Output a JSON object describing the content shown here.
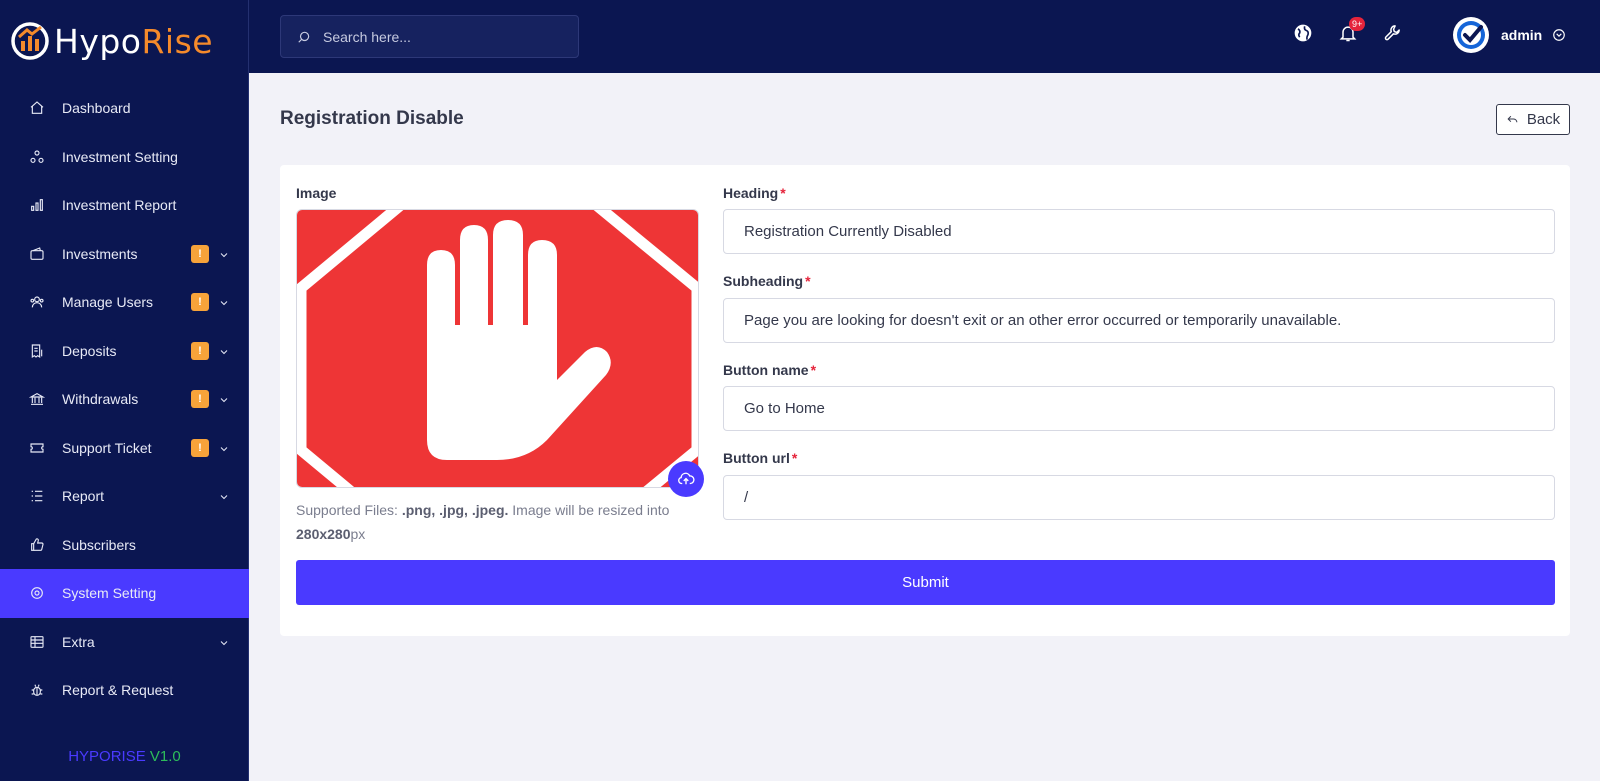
{
  "app": {
    "logo_part1": "Hypo",
    "logo_part2": "Rise",
    "version_name": "HYPORISE",
    "version_number": "V1.0"
  },
  "sidebar": {
    "items": [
      {
        "label": "Dashboard",
        "icon": "home-icon",
        "badge": "",
        "expandable": false,
        "active": false
      },
      {
        "label": "Investment Setting",
        "icon": "nodes-icon",
        "badge": "",
        "expandable": false,
        "active": false
      },
      {
        "label": "Investment Report",
        "icon": "bar-chart-icon",
        "badge": "",
        "expandable": false,
        "active": false
      },
      {
        "label": "Investments",
        "icon": "wallet-icon",
        "badge": "!",
        "expandable": true,
        "active": false
      },
      {
        "label": "Manage Users",
        "icon": "users-icon",
        "badge": "!",
        "expandable": true,
        "active": false
      },
      {
        "label": "Deposits",
        "icon": "receipt-icon",
        "badge": "!",
        "expandable": true,
        "active": false
      },
      {
        "label": "Withdrawals",
        "icon": "bank-icon",
        "badge": "!",
        "expandable": true,
        "active": false
      },
      {
        "label": "Support Ticket",
        "icon": "ticket-icon",
        "badge": "!",
        "expandable": true,
        "active": false
      },
      {
        "label": "Report",
        "icon": "list-icon",
        "badge": "",
        "expandable": true,
        "active": false
      },
      {
        "label": "Subscribers",
        "icon": "thumbs-up-icon",
        "badge": "",
        "expandable": false,
        "active": false
      },
      {
        "label": "System Setting",
        "icon": "settings-icon",
        "badge": "",
        "expandable": false,
        "active": true
      },
      {
        "label": "Extra",
        "icon": "table-icon",
        "badge": "",
        "expandable": true,
        "active": false
      },
      {
        "label": "Report & Request",
        "icon": "bug-icon",
        "badge": "",
        "expandable": false,
        "active": false
      }
    ]
  },
  "header": {
    "search_placeholder": "Search here...",
    "notification_count": "9+",
    "user_name": "admin"
  },
  "page": {
    "title": "Registration Disable",
    "back_label": "Back"
  },
  "form": {
    "image_label": "Image",
    "supported_prefix": "Supported Files: ",
    "supported_types": ".png, .jpg, .jpeg.",
    "supported_middle": " Image will be resized into ",
    "supported_size": "280x280",
    "supported_suffix": "px",
    "heading_label": "Heading",
    "heading_value": "Registration Currently Disabled",
    "subheading_label": "Subheading",
    "subheading_value": "Page you are looking for doesn't exit or an other error occurred or temporarily unavailable.",
    "button_name_label": "Button name",
    "button_name_value": "Go to Home",
    "button_url_label": "Button url",
    "button_url_value": "/",
    "required_mark": "*",
    "submit_label": "Submit"
  },
  "colors": {
    "sidebar_bg": "#0b1651",
    "accent": "#4a3aff",
    "badge": "#f7a33a",
    "logo_accent": "#f58a2b",
    "stop_sign_red": "#ee3536"
  }
}
